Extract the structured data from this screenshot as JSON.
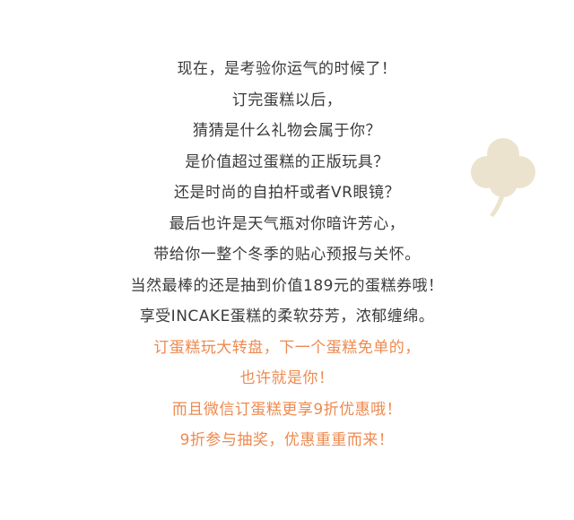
{
  "lines": [
    {
      "text": "现在，是考验你运气的时候了！",
      "color": "#3a3a3a"
    },
    {
      "text": "订完蛋糕以后，",
      "color": "#3a3a3a"
    },
    {
      "text": "猜猜是什么礼物会属于你？",
      "color": "#3a3a3a"
    },
    {
      "text": "是价值超过蛋糕的正版玩具？",
      "color": "#3a3a3a"
    },
    {
      "text": "还是时尚的自拍杆或者VR眼镜？",
      "color": "#3a3a3a"
    },
    {
      "text": "最后也许是天气瓶对你暗许芳心，",
      "color": "#3a3a3a"
    },
    {
      "text": "带给你一整个冬季的贴心预报与关怀。",
      "color": "#3a3a3a"
    },
    {
      "text": "当然最棒的还是抽到价值189元的蛋糕券哦！",
      "color": "#3a3a3a"
    },
    {
      "text": "享受INCAKE蛋糕的柔软芬芳，浓郁缠绵。",
      "color": "#3a3a3a"
    },
    {
      "text": "订蛋糕玩大转盘，下一个蛋糕免单的，",
      "color": "#ee8a4f"
    },
    {
      "text": "也许就是你！",
      "color": "#ee8a4f"
    },
    {
      "text": "而且微信订蛋糕更享9折优惠哦！",
      "color": "#ee8a4f"
    },
    {
      "text": "9折参与抽奖，优惠重重而来！",
      "color": "#ee8a4f"
    }
  ],
  "decoration": {
    "icon": "clover-icon",
    "color": "#ece3cf"
  }
}
